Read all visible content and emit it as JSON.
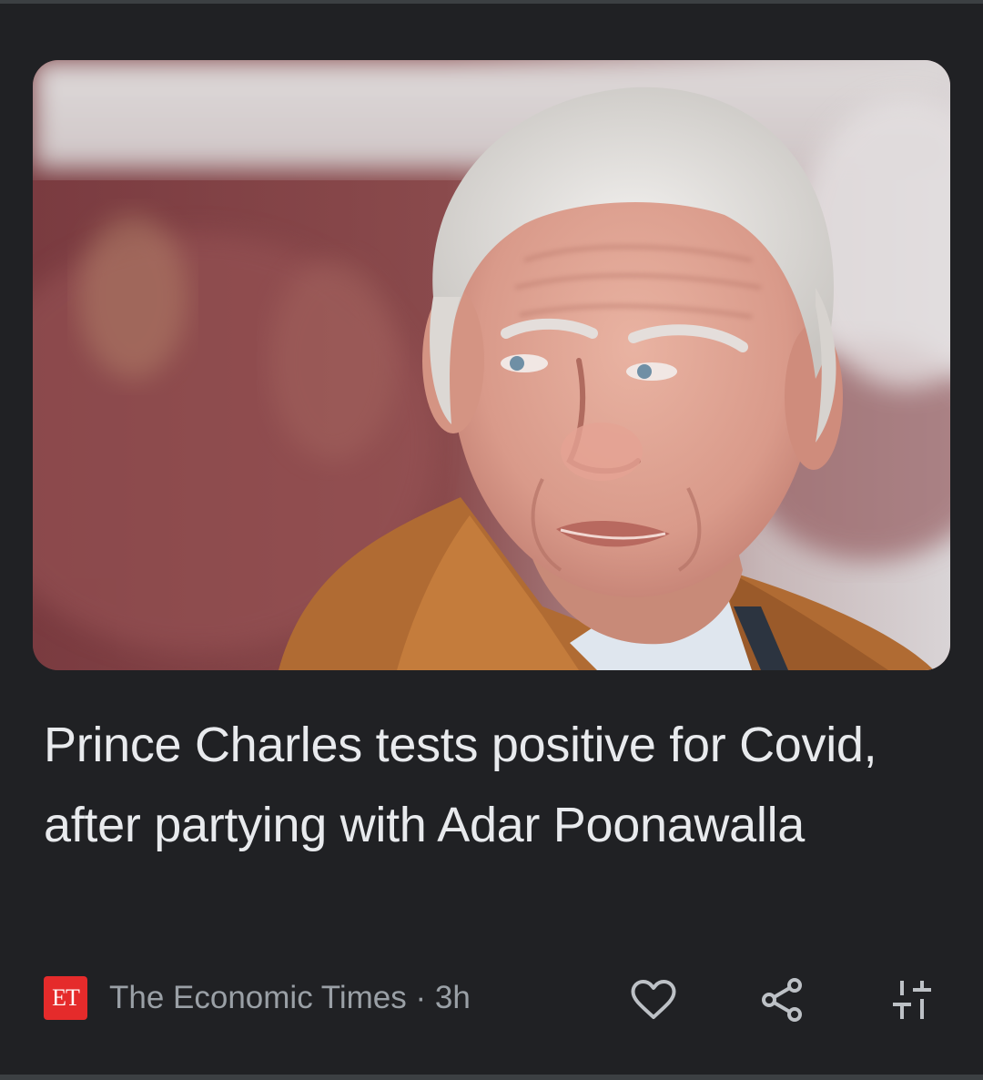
{
  "article": {
    "headline": "Prince Charles tests positive for Covid, after partying with Adar Poonawalla",
    "image_icon": "article-photo"
  },
  "source": {
    "logo_text": "ET",
    "name": "The Economic Times",
    "separator": "·",
    "age": "3h",
    "logo_color": "#e52b2b"
  },
  "actions": {
    "like_icon": "heart-icon",
    "share_icon": "share-icon",
    "more_icon": "sliders-icon"
  },
  "theme": {
    "background": "#202124",
    "headline_color": "#e8eaed",
    "meta_color": "#9aa0a6"
  }
}
